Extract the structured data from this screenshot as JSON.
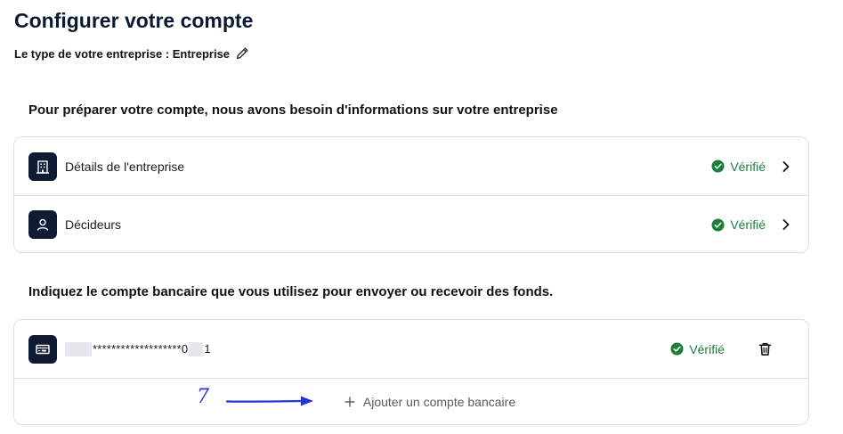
{
  "page": {
    "title": "Configurer votre compte",
    "business_type": "Le type de votre entreprise : Entreprise"
  },
  "company_section": {
    "heading": "Pour préparer votre compte, nous avons besoin d'informations sur votre entreprise",
    "items": [
      {
        "label": "Détails de l'entreprise",
        "status": "Vérifié",
        "icon": "building-icon"
      },
      {
        "label": "Décideurs",
        "status": "Vérifié",
        "icon": "user-icon"
      }
    ]
  },
  "bank_section": {
    "heading": "Indiquez le compte bancaire que vous utilisez pour envoyer ou recevoir des fonds.",
    "account": {
      "masked_middle": "*******************0",
      "masked_end": "1",
      "status": "Vérifié",
      "icon": "bank-account-icon"
    },
    "add_label": "Ajouter un compte bancaire"
  },
  "annotation": {
    "step": "7"
  },
  "colors": {
    "verified": "#1b7f3b",
    "icon_bg": "#0f1b33",
    "annotation": "#2436d8"
  }
}
